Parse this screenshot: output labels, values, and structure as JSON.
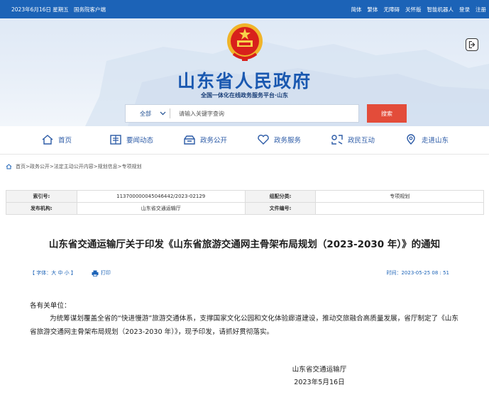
{
  "topbar": {
    "date": "2023年6月16日 星期五",
    "link_gov": "国务院客户端",
    "links": [
      "简体",
      "繁体",
      "无障碍",
      "关怀版",
      "智能机器人",
      "登录",
      "注册"
    ]
  },
  "header": {
    "site_title": "山东省人民政府",
    "site_subtitle": "全国一体化在线政务服务平台·山东"
  },
  "search": {
    "category": "全部",
    "placeholder": "请输入关键字查询",
    "button": "搜索"
  },
  "nav": [
    "首页",
    "要闻动态",
    "政务公开",
    "政务服务",
    "政民互动",
    "走进山东"
  ],
  "breadcrumb": "首页>政务公开>法定主动公开内容>规划信息>专项规划",
  "info": {
    "index_label": "索引号:",
    "index_value": "113700000045046442/2023-02129",
    "category_label": "组配分类:",
    "category_value": "专项规划",
    "issuer_label": "发布机构:",
    "issuer_value": "山东省交通运输厅",
    "docno_label": "文件编号:",
    "docno_value": ""
  },
  "document": {
    "title": "山东省交通运输厅关于印发《山东省旅游交通网主骨架布局规划（2023-2030 年）》的通知",
    "font_size_control": "【 字体：大 中 小 】",
    "print_label": "打印",
    "publish_time": "时间：2023-05-25 08 : 51",
    "salutation": "各有关单位：",
    "paragraph": "为统筹谋划覆盖全省的“快进慢游”旅游交通体系，支撑国家文化公园和文化体验廊道建设，推动交旅融合高质量发展，省厅制定了《山东省旅游交通网主骨架布局规划（2023-2030 年）》，现予印发，请抓好贯彻落实。",
    "signer": "山东省交通运输厅",
    "sign_date": "2023年5月16日"
  },
  "colors": {
    "primary_blue": "#1c63b7",
    "title_blue": "#1a58b0",
    "search_red": "#e34c3a"
  }
}
